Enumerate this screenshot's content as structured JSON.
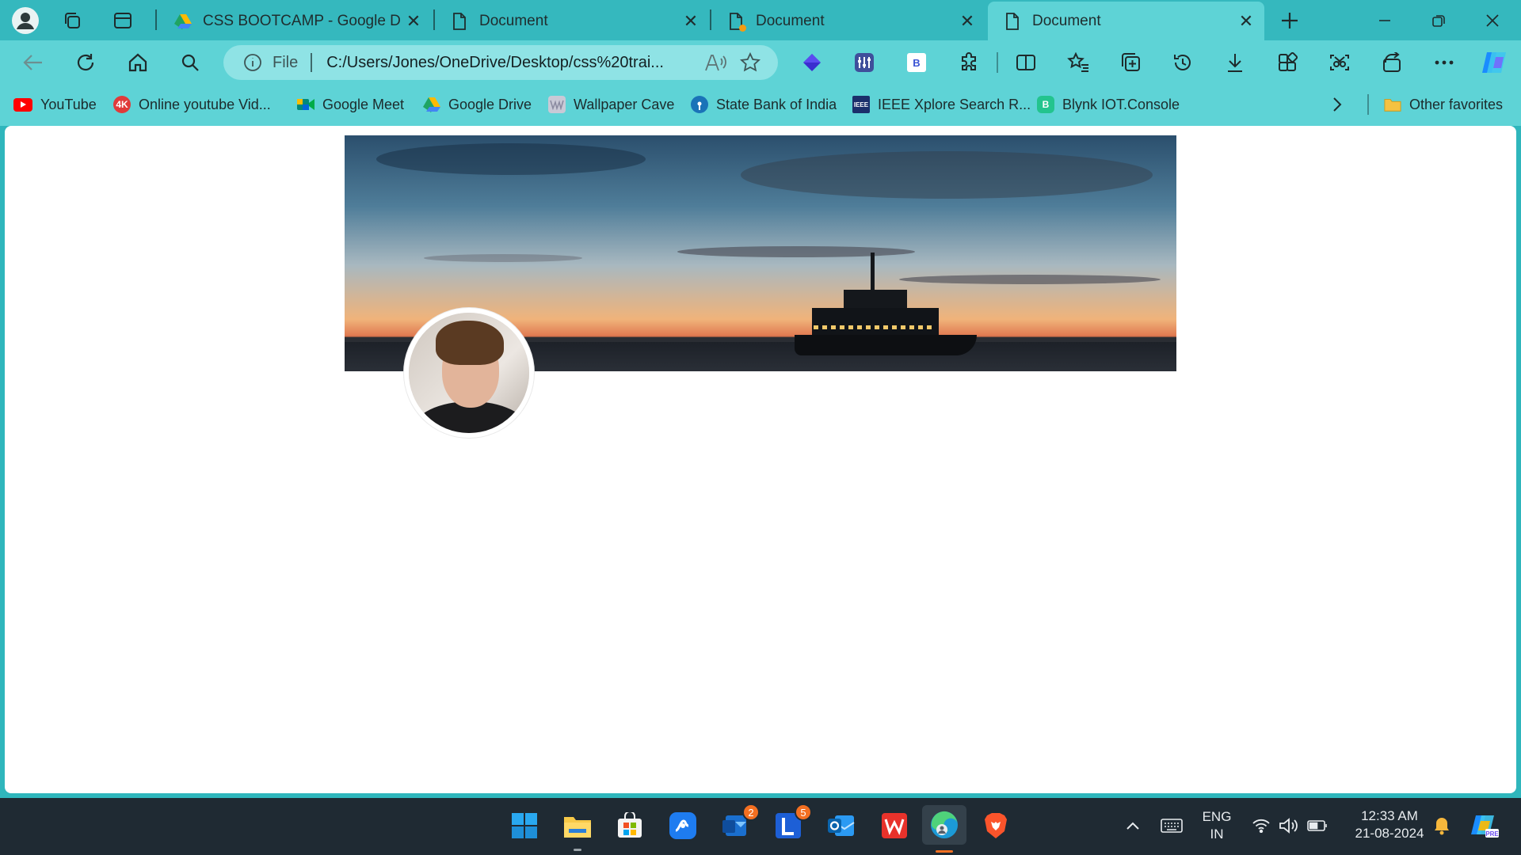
{
  "browser": {
    "tabs": [
      {
        "title": "CSS BOOTCAMP - Google Drive",
        "favicon": "google-drive-icon",
        "active": false
      },
      {
        "title": "Document",
        "favicon": "document-icon",
        "active": false
      },
      {
        "title": "Document",
        "favicon": "document-icon",
        "active": false
      },
      {
        "title": "Document",
        "favicon": "document-icon",
        "active": true
      }
    ],
    "address": {
      "scheme": "File",
      "url": "C:/Users/Jones/OneDrive/Desktop/css%20trai..."
    },
    "favorites": [
      {
        "label": "YouTube",
        "icon": "youtube-icon",
        "color": "#ff0000"
      },
      {
        "label": "Online youtube Vid...",
        "icon": "4k-downloader-icon",
        "color": "#e03a3a"
      },
      {
        "label": "Google Meet",
        "icon": "google-meet-icon",
        "color": "#00897b"
      },
      {
        "label": "Google Drive",
        "icon": "google-drive-icon",
        "color": "#1fa463"
      },
      {
        "label": "Wallpaper Cave",
        "icon": "wallpaper-cave-icon",
        "color": "#b3b3c4"
      },
      {
        "label": "State Bank of India",
        "icon": "sbi-icon",
        "color": "#1a73b8"
      },
      {
        "label": "IEEE Xplore Search R...",
        "icon": "ieee-icon",
        "color": "#1b2f6b"
      },
      {
        "label": "Blynk IOT.Console",
        "icon": "blynk-icon",
        "color": "#23c48e"
      }
    ],
    "other_favorites": "Other favorites"
  },
  "taskbar": {
    "badges": {
      "outlook_mail": "2",
      "lens": "5"
    },
    "tray": {
      "lang_top": "ENG",
      "lang_bottom": "IN",
      "time": "12:33 AM",
      "date": "21-08-2024"
    }
  },
  "colors": {
    "accent": "#5ed3d6",
    "tabstrip": "#35b8be",
    "taskbar": "#1f2a33",
    "badge": "#f36f21"
  }
}
